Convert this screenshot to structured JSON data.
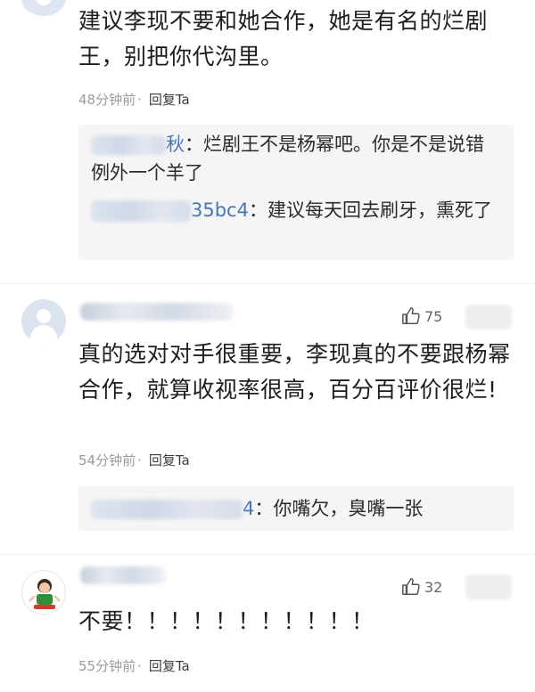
{
  "comment1": {
    "text": "建议李现不要和她合作，她是有名的烂剧王，别把你代沟里。",
    "time": "48分钟前",
    "reply_label": "回复Ta",
    "replies": [
      {
        "name_visible": "秋",
        "text": "：烂剧王不是杨幂吧。你是不是说错例外一个羊了"
      },
      {
        "name_visible": "35bc4",
        "text": "：建议每天回去刷牙，熏死了"
      }
    ]
  },
  "comment2": {
    "likes": "75",
    "text": "真的选对对手很重要，李现真的不要跟杨幂合作，就算收视率很高，百分百评价很烂!",
    "time": "54分钟前",
    "reply_label": "回复Ta",
    "replies": [
      {
        "name_visible": "4",
        "text": "：你嘴欠，臭嘴一张"
      }
    ]
  },
  "comment3": {
    "likes": "32",
    "text": "不要！！！！！！！！！！！",
    "time": "55分钟前",
    "reply_label": "回复Ta"
  },
  "icons": {
    "like": "thumbs-up-icon",
    "avatar": "user-avatar-icon"
  },
  "colors": {
    "username": "#4a76b8",
    "meta": "#9a9a9a",
    "reply_bg": "#f5f5f5"
  }
}
